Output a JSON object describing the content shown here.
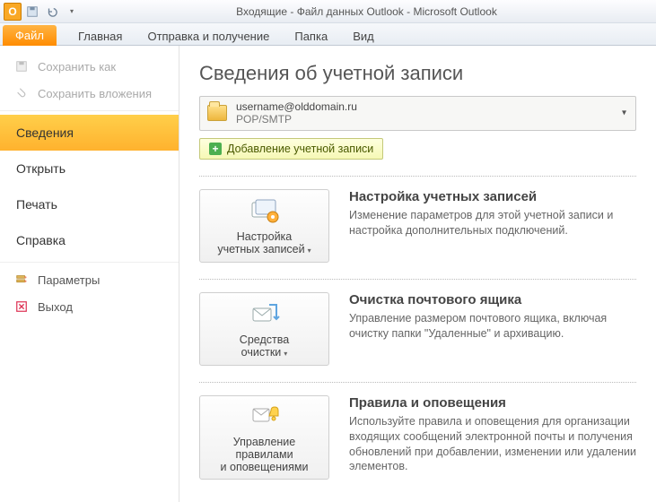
{
  "window": {
    "title": "Входящие - Файл данных Outlook  -  Microsoft Outlook"
  },
  "qat": {
    "app_letter": "O"
  },
  "tabs": {
    "file": "Файл",
    "home": "Главная",
    "sendrecv": "Отправка и получение",
    "folder": "Папка",
    "view": "Вид"
  },
  "sidebar": {
    "save_as": "Сохранить как",
    "save_attachments": "Сохранить вложения",
    "info": "Сведения",
    "open": "Открыть",
    "print": "Печать",
    "help": "Справка",
    "options": "Параметры",
    "exit": "Выход"
  },
  "page": {
    "title": "Сведения об учетной записи",
    "account_email": "username@olddomain.ru",
    "account_proto": "POP/SMTP",
    "add_account": "Добавление учетной записи"
  },
  "sections": {
    "acct": {
      "btn1": "Настройка",
      "btn2": "учетных записей",
      "title": "Настройка учетных записей",
      "desc": "Изменение параметров для этой учетной записи и настройка дополнительных подключений."
    },
    "cleanup": {
      "btn1": "Средства",
      "btn2": "очистки",
      "title": "Очистка почтового ящика",
      "desc": "Управление размером почтового ящика, включая очистку папки \"Удаленные\" и архивацию."
    },
    "rules": {
      "btn1": "Управление правилами",
      "btn2": "и оповещениями",
      "title": "Правила и оповещения",
      "desc": "Используйте правила и оповещения для организации входящих сообщений электронной почты и получения обновлений при добавлении, изменении или удалении элементов."
    }
  }
}
